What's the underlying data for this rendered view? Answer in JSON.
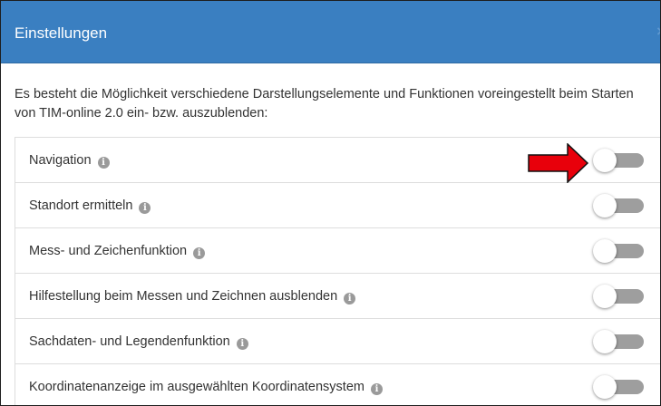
{
  "dialog": {
    "title": "Einstellungen",
    "close_label": "×",
    "intro": "Es besteht die Möglichkeit verschiedene Darstellungselemente und Funktionen voreingestellt beim Starten von TIM-online 2.0 ein- bzw. auszublenden:"
  },
  "settings": [
    {
      "label": "Navigation",
      "enabled": false
    },
    {
      "label": "Standort ermitteln",
      "enabled": false
    },
    {
      "label": "Mess- und Zeichenfunktion",
      "enabled": false
    },
    {
      "label": "Hilfestellung beim Messen und Zeichnen ausblenden",
      "enabled": false
    },
    {
      "label": "Sachdaten- und Legendenfunktion",
      "enabled": false
    },
    {
      "label": "Koordinatenanzeige im ausgewählten Koordinatensystem",
      "enabled": false
    }
  ],
  "icons": {
    "info": "info-circle-icon",
    "annotation": "red-arrow-icon"
  },
  "colors": {
    "header": "#3a7fc1",
    "arrow": "#e8000b",
    "track_off": "#9e9e9e"
  }
}
